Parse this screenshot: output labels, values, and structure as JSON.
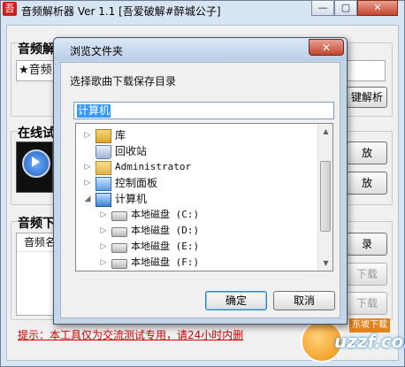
{
  "main_window": {
    "title": "音频解析器 Ver 1.1 [吾爱破解#醉城公子]",
    "app_icon_text": "吾",
    "controls": {
      "minimize": "—",
      "restore": "▢",
      "close": "✕"
    },
    "section_parse": {
      "title": "音频解",
      "input_value": "★音频",
      "button_label": "键解析"
    },
    "section_online": {
      "title": "在线试",
      "button1_label": "放",
      "button2_label": "放"
    },
    "section_download": {
      "title": "音频下",
      "column_header": "音频名",
      "btn_record": "录",
      "btn_download1": "下载",
      "btn_download2": "下载"
    },
    "notice": "提示：本工具仅为交流测试专用，请24小时内删"
  },
  "dialog": {
    "title": "浏览文件夹",
    "close_label": "✕",
    "prompt": "选择歌曲下载保存目录",
    "selected_folder": "计算机",
    "tree_items": [
      {
        "label": "库",
        "icon": "library-icon",
        "expander": "▷",
        "indent": 0
      },
      {
        "label": "回收站",
        "icon": "recycle-bin-icon",
        "expander": "",
        "indent": 0
      },
      {
        "label": "Administrator",
        "icon": "user-folder-icon",
        "expander": "▷",
        "indent": 0
      },
      {
        "label": "控制面板",
        "icon": "control-panel-icon",
        "expander": "▷",
        "indent": 0
      },
      {
        "label": "计算机",
        "icon": "computer-icon",
        "expander": "◢",
        "indent": 0
      },
      {
        "label": "本地磁盘 (C:)",
        "icon": "drive-icon",
        "expander": "▷",
        "indent": 1
      },
      {
        "label": "本地磁盘 (D:)",
        "icon": "drive-icon",
        "expander": "▷",
        "indent": 1
      },
      {
        "label": "本地磁盘 (E:)",
        "icon": "drive-icon",
        "expander": "▷",
        "indent": 1
      },
      {
        "label": "本地磁盘 (F:)",
        "icon": "drive-icon",
        "expander": "▷",
        "indent": 1
      }
    ],
    "ok_label": "确定",
    "cancel_label": "取消"
  },
  "watermark": {
    "text": "uzzf.com",
    "badge": "东坡下载"
  }
}
